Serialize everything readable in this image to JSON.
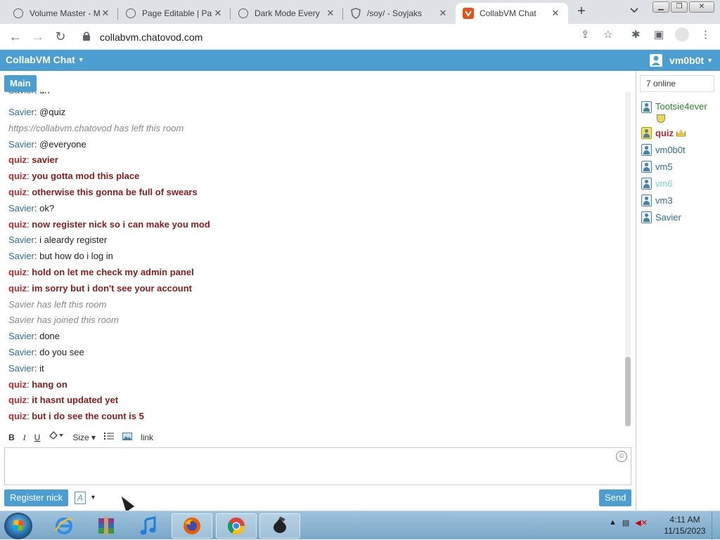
{
  "browser": {
    "tabs": [
      {
        "title": "Volume Master - M",
        "icon": "globe-icon"
      },
      {
        "title": "Page Editable | Pa",
        "icon": "globe-icon"
      },
      {
        "title": "Dark Mode Every",
        "icon": "globe-icon"
      },
      {
        "title": "/soy/ - Soyjaks",
        "icon": "shield-icon"
      },
      {
        "title": "CollabVM Chat",
        "icon": "chatovod-icon",
        "active": true
      }
    ],
    "new_tab": "+",
    "close_glyph": "✕",
    "url": "collabvm.chatovod.com"
  },
  "app": {
    "brand": "CollabVM Chat",
    "username": "vm0b0t",
    "room_tab": "Main",
    "accent": "#4a9fd0"
  },
  "messages": [
    {
      "nick": "Savier",
      "sep": ": ",
      "text": "@quiz",
      "kind": "s"
    },
    {
      "text": "https://collabvm.chatovod has left this room",
      "kind": "sys"
    },
    {
      "nick": "Savier",
      "sep": ": ",
      "text": "@everyone",
      "kind": "s"
    },
    {
      "nick": "quiz",
      "sep": ": ",
      "text": "savier",
      "kind": "q"
    },
    {
      "nick": "quiz",
      "sep": ": ",
      "text": "you gotta mod this place",
      "kind": "q"
    },
    {
      "nick": "quiz",
      "sep": ": ",
      "text": "otherwise this gonna be full of swears",
      "kind": "q"
    },
    {
      "nick": "Savier",
      "sep": ": ",
      "text": "ok?",
      "kind": "s"
    },
    {
      "nick": "quiz",
      "sep": ": ",
      "text": "now register nick so i can make you mod",
      "kind": "q"
    },
    {
      "nick": "Savier",
      "sep": ": ",
      "text": "i aleardy register",
      "kind": "s"
    },
    {
      "nick": "Savier",
      "sep": ": ",
      "text": "but how do i log in",
      "kind": "s"
    },
    {
      "nick": "quiz",
      "sep": ": ",
      "text": "hold on let me check my admin panel",
      "kind": "q"
    },
    {
      "nick": "quiz",
      "sep": ": ",
      "text": "im sorry but i don't see your account",
      "kind": "q"
    },
    {
      "text": "Savier has left this room",
      "kind": "sys"
    },
    {
      "text": "Savier has joined this room",
      "kind": "sys"
    },
    {
      "nick": "Savier",
      "sep": ": ",
      "text": "done",
      "kind": "s"
    },
    {
      "nick": "Savier",
      "sep": ": ",
      "text": "do you see",
      "kind": "s"
    },
    {
      "nick": "Savier",
      "sep": ": ",
      "text": "it",
      "kind": "s"
    },
    {
      "nick": "quiz",
      "sep": ": ",
      "text": "hang on",
      "kind": "q"
    },
    {
      "nick": "quiz",
      "sep": ": ",
      "text": "it hasnt updated yet",
      "kind": "q"
    },
    {
      "nick": "quiz",
      "sep": ": ",
      "text": "but i do see the count is 5",
      "kind": "q"
    }
  ],
  "editor": {
    "bold": "B",
    "italic": "I",
    "underline": "U",
    "size": "Size",
    "link": "link",
    "font_letter": "A",
    "register_button": "Register nick",
    "send_button": "Send"
  },
  "userlist": {
    "online": "7 online",
    "users": [
      {
        "name": "Tootsie4ever",
        "color": "#2a8a2a",
        "badge": "shield"
      },
      {
        "name": "quiz",
        "color": "#c1272d",
        "bold": true,
        "badge": "crown",
        "icon_color": "yellow"
      },
      {
        "name": "vm0b0t",
        "color": "#2a6e9e"
      },
      {
        "name": "vm5",
        "color": "#2a6e9e"
      },
      {
        "name": "vm6",
        "color": "#6fd6cf"
      },
      {
        "name": "vm3",
        "color": "#2a6e9e"
      },
      {
        "name": "Savier",
        "color": "#2a6e9e"
      }
    ]
  },
  "taskbar": {
    "apps": [
      "internet-explorer-icon",
      "winrar-icon",
      "itunes-icon",
      "firefox-icon",
      "chrome-icon",
      "app-icon"
    ],
    "time": "4:11 AM",
    "date": "11/15/2023"
  }
}
